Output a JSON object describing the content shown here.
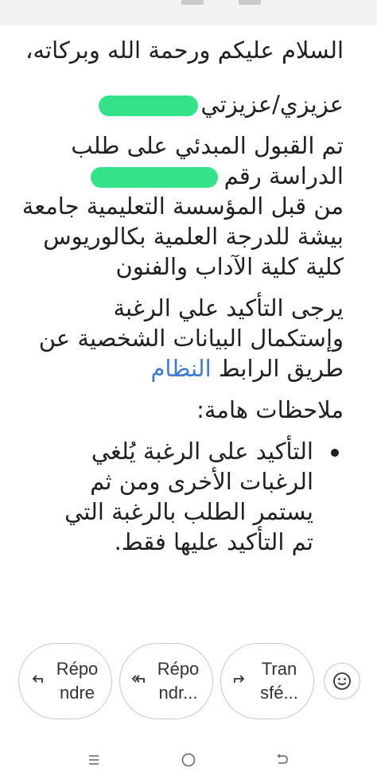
{
  "email": {
    "greeting": "السلام عليكم ورحمة الله وبركاته،",
    "salutation": "عزيزي/عزيزتي",
    "body_lines": [
      "تم القبول المبدئي على طلب",
      "الدراسة رقم",
      "من قبل المؤسسة التعليمية جامعة",
      "بيشة  للدرجة العلمية بكالوريوس",
      "كلية  كلية الآداب والفنون"
    ],
    "confirm_lines": [
      "يرجى التأكيد علي الرغبة",
      "وإستكمال البيانات الشخصية عن",
      "طريق الرابط"
    ],
    "link_text": "النظام",
    "notes_title": "ملاحظات هامة:",
    "note_lines": [
      "التأكيد على الرغبة يُلغي",
      "الرغبات الأخرى ومن ثم",
      "يستمر الطلب بالرغبة التي",
      "تم التأكيد عليها فقط."
    ]
  },
  "actions": {
    "reply": {
      "line1": "Répo",
      "line2": "ndre",
      "icon": "reply-icon"
    },
    "reply_all": {
      "line1": "Répo",
      "line2": "ndr...",
      "icon": "reply-all-icon"
    },
    "forward": {
      "line1": "Tran",
      "line2": "sfé...",
      "icon": "forward-icon"
    },
    "emoji": {
      "icon": "emoji-icon"
    }
  },
  "nav": {
    "recents": "recents-icon",
    "home": "home-icon",
    "back": "back-icon"
  }
}
